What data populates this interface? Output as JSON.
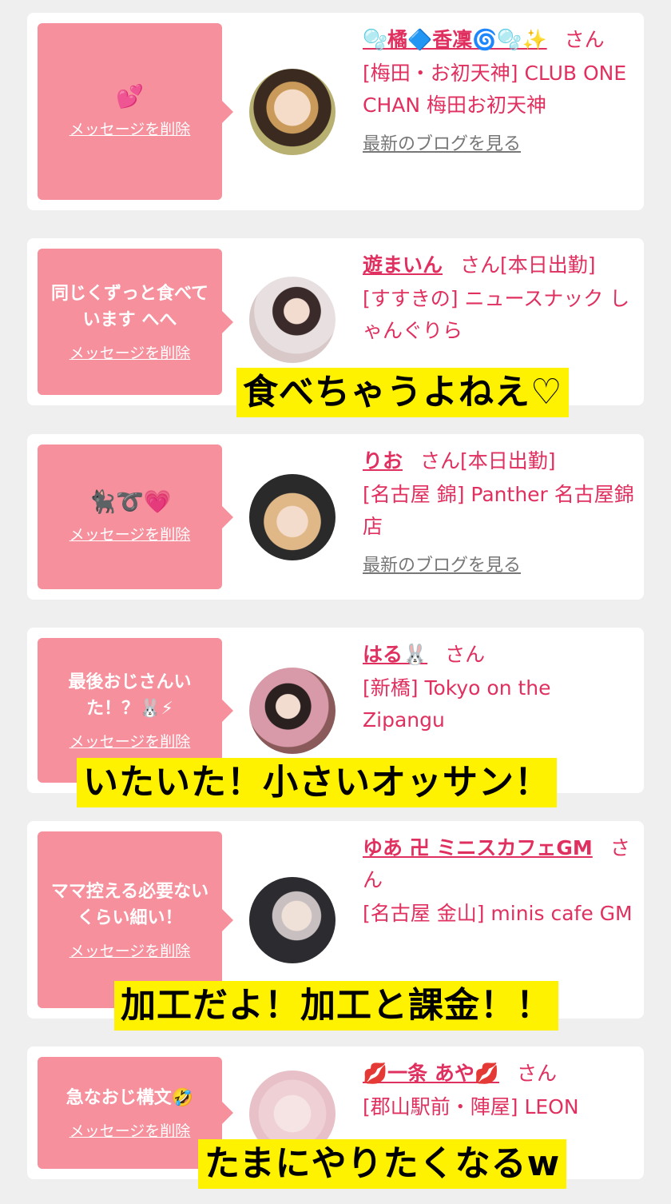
{
  "delete_label": "メッセージを削除",
  "blog_label": "最新のブログを見る",
  "cards": [
    {
      "message": "💕",
      "name": "🫧橘🔷香凜🌀🫧✨",
      "san": "さん",
      "shop": "[梅田・お初天神] CLUB ONE CHAN 梅田お初天神",
      "has_blog": true
    },
    {
      "message": "同じくずっと食べています へへ",
      "name": "遊まいん",
      "san": "さん[本日出勤]",
      "shop": "[すすきの] ニュースナック しゃんぐりら",
      "caption": "食べちゃうよねえ♡"
    },
    {
      "message": "🐈‍⬛➰💗",
      "name": "りお",
      "san": "さん[本日出勤]",
      "shop": "[名古屋 錦] Panther 名古屋錦店",
      "has_blog": true
    },
    {
      "message": "最後おじさんいた！？🐰⚡",
      "name": "はる🐰",
      "san": "さん",
      "shop": "[新橋] Tokyo on the Zipangu",
      "caption": "いたいた！小さいオッサン！"
    },
    {
      "message": "ママ控える必要ないくらい細い！",
      "name": "ゆあ 卍 ミニスカフェGM",
      "san": "さん",
      "shop": "[名古屋 金山] minis cafe GM",
      "caption": "加工だよ！加工と課金！！"
    },
    {
      "message": "急なおじ構文🤣",
      "name": "💋一条 あや💋",
      "san": "さん",
      "shop": "[郡山駅前・陣屋] LEON",
      "caption": "たまにやりたくなるw"
    }
  ],
  "colors": {
    "accent": "#e0305f",
    "bubble": "#f5909c",
    "caption_bg": "#fff200",
    "page_bg": "#efefef"
  }
}
